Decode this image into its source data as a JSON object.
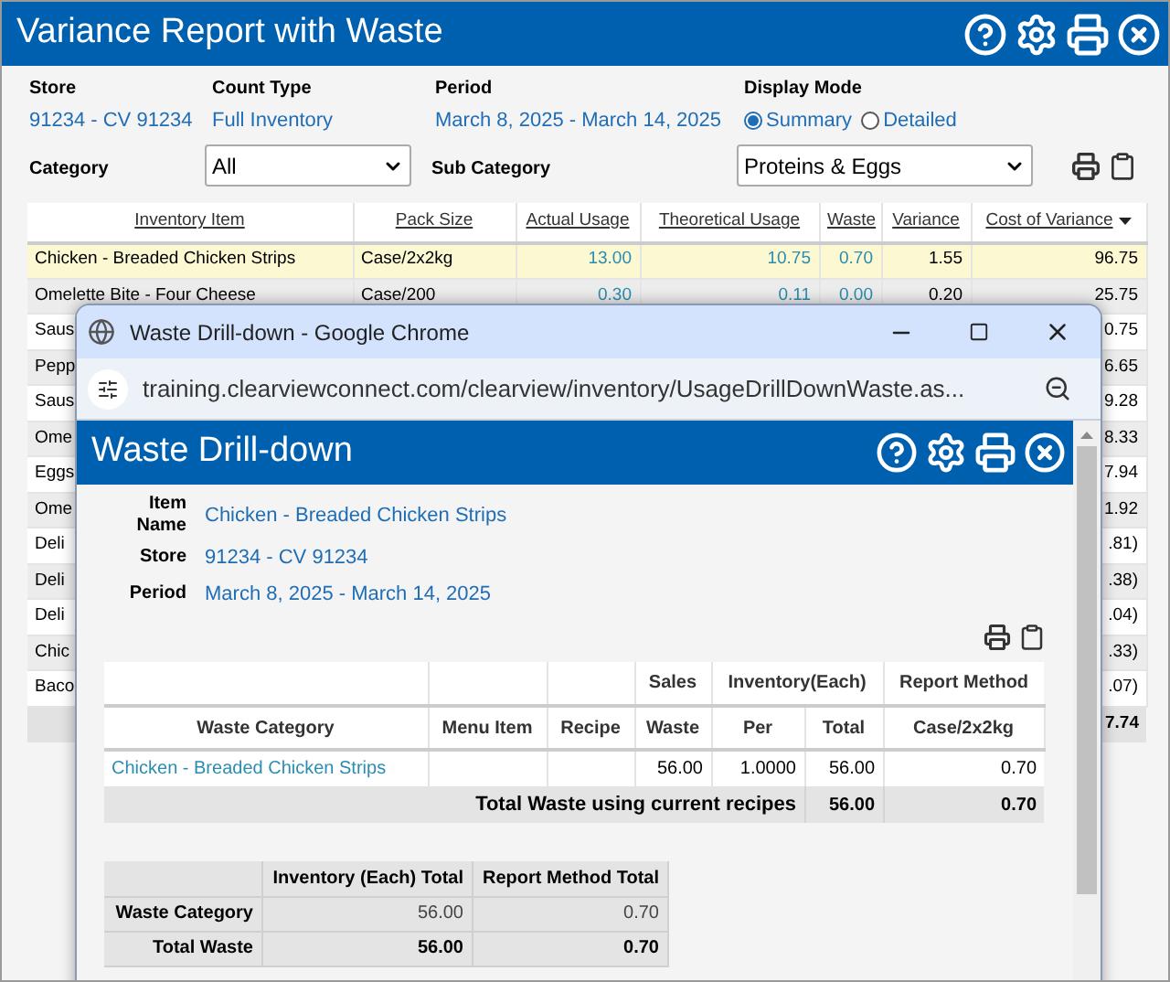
{
  "window": {
    "title": "Variance Report with Waste"
  },
  "filters": {
    "store": {
      "label": "Store",
      "value": "91234 - CV 91234"
    },
    "count_type": {
      "label": "Count Type",
      "value": "Full Inventory"
    },
    "period": {
      "label": "Period",
      "value": "March 8, 2025 - March 14, 2025"
    },
    "display_mode": {
      "label": "Display Mode",
      "options": [
        {
          "label": "Summary",
          "selected": true
        },
        {
          "label": "Detailed",
          "selected": false
        }
      ]
    },
    "category": {
      "label": "Category",
      "value": "All"
    },
    "sub_category": {
      "label": "Sub Category",
      "value": "Proteins & Eggs"
    }
  },
  "table": {
    "columns": [
      {
        "label": "Inventory Item",
        "sorted": false
      },
      {
        "label": "Pack Size",
        "sorted": false
      },
      {
        "label": "Actual Usage",
        "sorted": false
      },
      {
        "label": "Theoretical Usage",
        "sorted": false
      },
      {
        "label": "Waste",
        "sorted": false
      },
      {
        "label": "Variance",
        "sorted": false
      },
      {
        "label": "Cost of Variance",
        "sorted": true
      }
    ],
    "rows": [
      {
        "selected": true,
        "cells": [
          "Chicken - Breaded Chicken Strips",
          "Case/2x2kg",
          "13.00",
          "10.75",
          "0.70",
          "1.55",
          "96.75"
        ]
      },
      {
        "selected": false,
        "cells": [
          "Omelette Bite - Four Cheese",
          "Case/200",
          "0.30",
          "0.11",
          "0.00",
          "0.20",
          "25.75"
        ]
      },
      {
        "selected": false,
        "item": "Saus",
        "cost": "0.75"
      },
      {
        "selected": false,
        "item": "Pepp",
        "cost": "6.65"
      },
      {
        "selected": false,
        "item": "Saus",
        "cost": "9.28"
      },
      {
        "selected": false,
        "item": "Ome",
        "cost": "8.33"
      },
      {
        "selected": false,
        "item": "Eggs",
        "cost": "7.94"
      },
      {
        "selected": false,
        "item": "Ome",
        "cost": "1.92"
      },
      {
        "selected": false,
        "item": "Deli",
        "cost": ".81)"
      },
      {
        "selected": false,
        "item": "Deli",
        "cost": ".38)"
      },
      {
        "selected": false,
        "item": "Deli",
        "cost": ".04)"
      },
      {
        "selected": false,
        "item": "Chic",
        "cost": ".33)"
      },
      {
        "selected": false,
        "item": "Baco",
        "cost": ".07)"
      }
    ],
    "total": "7.74"
  },
  "popup": {
    "browser_title": "Waste Drill-down - Google Chrome",
    "url": "training.clearviewconnect.com/clearview/inventory/UsageDrillDownWaste.as...",
    "title": "Waste Drill-down",
    "details": [
      {
        "label": "Item Name",
        "value": "Chicken - Breaded Chicken Strips"
      },
      {
        "label": "Store",
        "value": "91234 - CV 91234"
      },
      {
        "label": "Period",
        "value": "March 8, 2025 - March 14, 2025"
      }
    ],
    "waste_table": {
      "group_headers": {
        "sales": "Sales",
        "inventory": "Inventory(Each)",
        "report_method": "Report Method"
      },
      "columns": [
        "Waste Category",
        "Menu Item",
        "Recipe",
        "Waste",
        "Per",
        "Total",
        "Case/2x2kg"
      ],
      "rows": [
        {
          "waste_category": "Chicken - Breaded Chicken Strips",
          "sales_waste": "56.00",
          "per": "1.0000",
          "total": "56.00",
          "report_method": "0.70"
        }
      ],
      "total": {
        "label": "Total Waste using current recipes",
        "total": "56.00",
        "report_method": "0.70"
      }
    },
    "summary_table": {
      "columns": [
        "Inventory (Each) Total",
        "Report Method Total"
      ],
      "rows": [
        {
          "label": "Waste Category",
          "values": [
            "56.00",
            "0.70"
          ],
          "bold": false
        },
        {
          "label": "Total Waste",
          "values": [
            "56.00",
            "0.70"
          ],
          "bold": true
        }
      ]
    }
  }
}
